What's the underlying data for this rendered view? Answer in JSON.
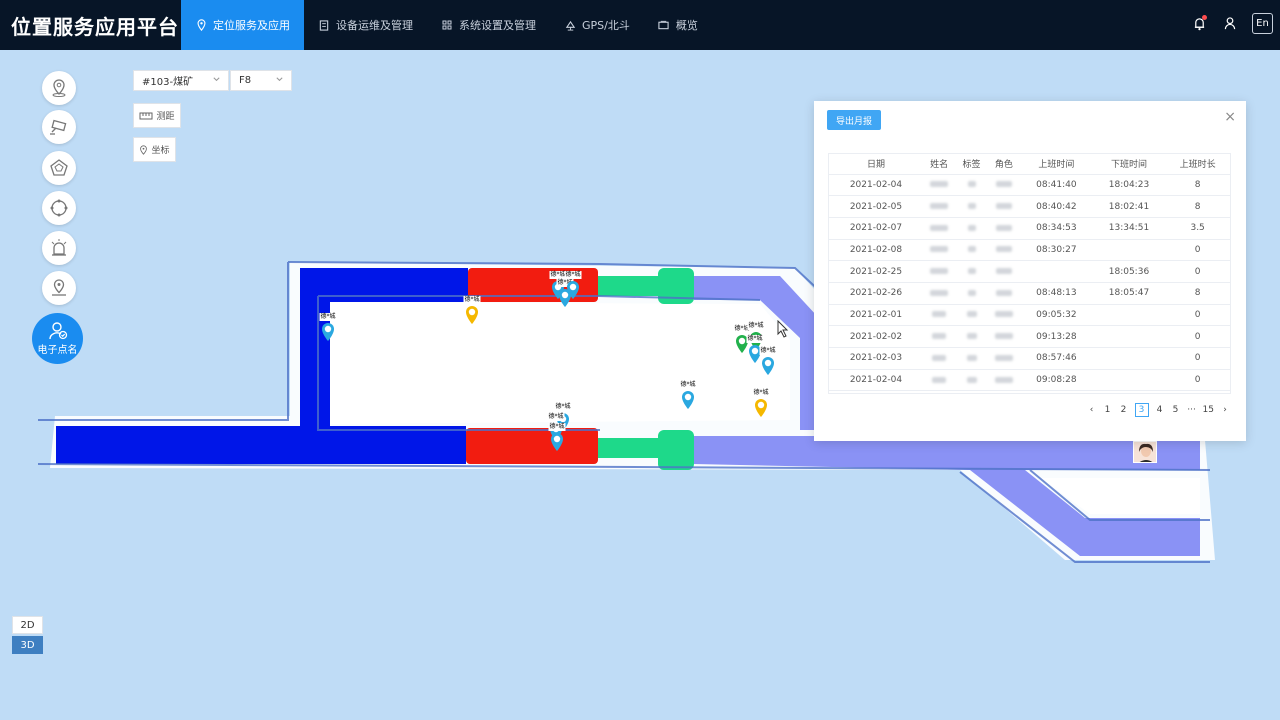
{
  "app": {
    "title": "位置服务应用平台"
  },
  "nav": [
    {
      "label": "定位服务及应用",
      "icon": "location-icon",
      "active": true
    },
    {
      "label": "设备运维及管理",
      "icon": "document-icon",
      "active": false
    },
    {
      "label": "系统设置及管理",
      "icon": "grid-icon",
      "active": false
    },
    {
      "label": "GPS/北斗",
      "icon": "satellite-icon",
      "active": false
    },
    {
      "label": "概览",
      "icon": "overview-icon",
      "active": false
    }
  ],
  "header": {
    "lang": "En"
  },
  "tools": {
    "roll_call_label": "电子点名"
  },
  "filters": {
    "site": "#103-煤矿",
    "floor": "F8"
  },
  "map_tools": {
    "measure": "测距",
    "coord": "坐标"
  },
  "view_mode": {
    "d2": "2D",
    "d3": "3D",
    "selected": "3D"
  },
  "markers": [
    {
      "label": "德*城",
      "color": "#f5b800"
    },
    {
      "label": "德*城",
      "color": "#2aa8e0"
    },
    {
      "label": "德*城",
      "color": "#2aa8e0"
    },
    {
      "label": "德*城",
      "color": "#2aa8e0"
    },
    {
      "label": "德*城",
      "color": "#2aa8e0"
    },
    {
      "label": "德*城",
      "color": "#2aa8e0"
    },
    {
      "label": "德*城",
      "color": "#2aa8e0"
    },
    {
      "label": "德*城",
      "color": "#2aa8e0"
    },
    {
      "label": "德*城",
      "color": "#2aa8e0"
    },
    {
      "label": "德*城",
      "color": "#22b14c"
    },
    {
      "label": "德*城",
      "color": "#22b14c"
    },
    {
      "label": "德*城",
      "color": "#2aa8e0"
    },
    {
      "label": "德*城",
      "color": "#2aa8e0"
    },
    {
      "label": "德*城",
      "color": "#f5b800"
    }
  ],
  "dialog": {
    "export_label": "导出月报",
    "close": "×",
    "columns": [
      "日期",
      "姓名",
      "标签",
      "角色",
      "上班时间",
      "下班时间",
      "上班时长"
    ],
    "rows": [
      {
        "date": "2021-02-04",
        "in": "08:41:40",
        "out": "18:04:23",
        "hours": "8"
      },
      {
        "date": "2021-02-05",
        "in": "08:40:42",
        "out": "18:02:41",
        "hours": "8"
      },
      {
        "date": "2021-02-07",
        "in": "08:34:53",
        "out": "13:34:51",
        "hours": "3.5"
      },
      {
        "date": "2021-02-08",
        "in": "08:30:27",
        "out": "",
        "hours": "0"
      },
      {
        "date": "2021-02-25",
        "in": "",
        "out": "18:05:36",
        "hours": "0"
      },
      {
        "date": "2021-02-26",
        "in": "08:48:13",
        "out": "18:05:47",
        "hours": "8"
      },
      {
        "date": "2021-02-01",
        "in": "09:05:32",
        "out": "",
        "hours": "0"
      },
      {
        "date": "2021-02-02",
        "in": "09:13:28",
        "out": "",
        "hours": "0"
      },
      {
        "date": "2021-02-03",
        "in": "08:57:46",
        "out": "",
        "hours": "0"
      },
      {
        "date": "2021-02-04",
        "in": "09:08:28",
        "out": "",
        "hours": "0"
      }
    ],
    "pager": {
      "prev": "‹",
      "pages": [
        "1",
        "2",
        "3",
        "4",
        "5"
      ],
      "current": "3",
      "ellipsis": "···",
      "last": "15",
      "next": "›"
    }
  },
  "colors": {
    "accent": "#1a8cf0",
    "topbar": "#071527",
    "map_bg": "#bfdcf6",
    "zone_blue": "#0010e0",
    "zone_red": "#f01a10",
    "zone_green": "#1ed98a",
    "zone_periwinkle": "#8a92f5"
  }
}
